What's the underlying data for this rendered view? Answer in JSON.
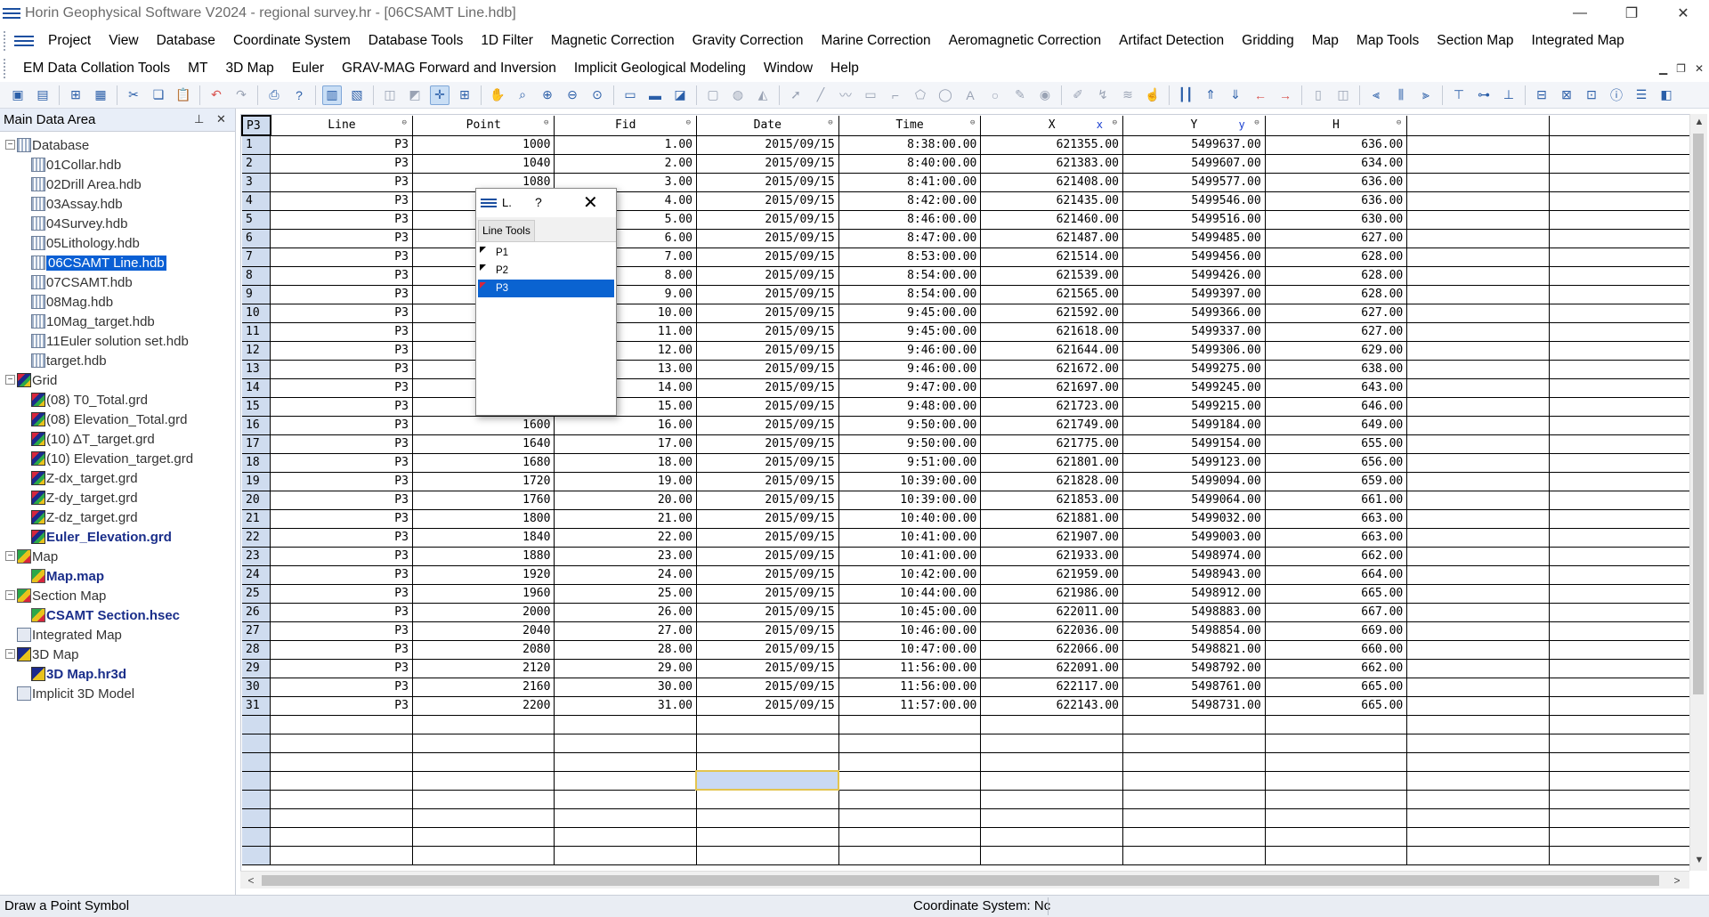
{
  "window": {
    "title": "Horin Geophysical Software V2024 - regional survey.hr - [06CSAMT Line.hdb]"
  },
  "menu1": [
    "Project",
    "View",
    "Database",
    "Coordinate System",
    "Database Tools",
    "1D Filter",
    "Magnetic Correction",
    "Gravity Correction",
    "Marine Correction",
    "Aeromagnetic Correction",
    "Artifact Detection",
    "Gridding",
    "Map",
    "Map Tools",
    "Section  Map",
    "Integrated Map"
  ],
  "menu2": [
    "EM Data Collation Tools",
    "MT",
    "3D Map",
    "Euler",
    "GRAV-MAG Forward and Inversion",
    "Implicit Geological Modeling",
    "Window",
    "Help"
  ],
  "panel": {
    "title": "Main Data Area"
  },
  "tree": {
    "database_label": "Database",
    "databases": [
      "01Collar.hdb",
      "02Drill Area.hdb",
      "03Assay.hdb",
      "04Survey.hdb",
      "05Lithology.hdb",
      "06CSAMT Line.hdb",
      "07CSAMT.hdb",
      "08Mag.hdb",
      "10Mag_target.hdb",
      "11Euler solution set.hdb",
      "target.hdb"
    ],
    "selected_database": "06CSAMT Line.hdb",
    "grid_label": "Grid",
    "grids": [
      "(08)  T0_Total.grd",
      "(08)  Elevation_Total.grd",
      "(10)  ΔT_target.grd",
      "(10)  Elevation_target.grd",
      "Z-dx_target.grd",
      "Z-dy_target.grd",
      "Z-dz_target.grd",
      "Euler_Elevation.grd"
    ],
    "bold_grid": "Euler_Elevation.grd",
    "map_label": "Map",
    "map_item": "Map.map",
    "section_label": "Section Map",
    "section_item": "CSAMT Section.hsec",
    "integrated_label": "Integrated Map",
    "map3d_label": "3D Map",
    "map3d_item": "3D Map.hr3d",
    "implicit_label": "Implicit 3D Model"
  },
  "grid": {
    "corner": "P3",
    "columns": [
      {
        "name": "Line",
        "sub": ""
      },
      {
        "name": "Point",
        "sub": ""
      },
      {
        "name": "Fid",
        "sub": ""
      },
      {
        "name": "Date",
        "sub": ""
      },
      {
        "name": "Time",
        "sub": ""
      },
      {
        "name": "X",
        "sub": "x"
      },
      {
        "name": "Y",
        "sub": "y"
      },
      {
        "name": "H",
        "sub": ""
      },
      {
        "name": "",
        "sub": ""
      },
      {
        "name": "",
        "sub": ""
      }
    ],
    "rows": [
      [
        "P3",
        "1000",
        "1.00",
        "2015/09/15",
        "8:38:00.00",
        "621355.00",
        "5499637.00",
        "636.00"
      ],
      [
        "P3",
        "1040",
        "2.00",
        "2015/09/15",
        "8:40:00.00",
        "621383.00",
        "5499607.00",
        "634.00"
      ],
      [
        "P3",
        "1080",
        "3.00",
        "2015/09/15",
        "8:41:00.00",
        "621408.00",
        "5499577.00",
        "636.00"
      ],
      [
        "P3",
        "",
        "4.00",
        "2015/09/15",
        "8:42:00.00",
        "621435.00",
        "5499546.00",
        "636.00"
      ],
      [
        "P3",
        "",
        "5.00",
        "2015/09/15",
        "8:46:00.00",
        "621460.00",
        "5499516.00",
        "630.00"
      ],
      [
        "P3",
        "",
        "6.00",
        "2015/09/15",
        "8:47:00.00",
        "621487.00",
        "5499485.00",
        "627.00"
      ],
      [
        "P3",
        "",
        "7.00",
        "2015/09/15",
        "8:53:00.00",
        "621514.00",
        "5499456.00",
        "628.00"
      ],
      [
        "P3",
        "",
        "8.00",
        "2015/09/15",
        "8:54:00.00",
        "621539.00",
        "5499426.00",
        "628.00"
      ],
      [
        "P3",
        "",
        "9.00",
        "2015/09/15",
        "8:54:00.00",
        "621565.00",
        "5499397.00",
        "628.00"
      ],
      [
        "P3",
        "",
        "10.00",
        "2015/09/15",
        "9:45:00.00",
        "621592.00",
        "5499366.00",
        "627.00"
      ],
      [
        "P3",
        "",
        "11.00",
        "2015/09/15",
        "9:45:00.00",
        "621618.00",
        "5499337.00",
        "627.00"
      ],
      [
        "P3",
        "",
        "12.00",
        "2015/09/15",
        "9:46:00.00",
        "621644.00",
        "5499306.00",
        "629.00"
      ],
      [
        "P3",
        "",
        "13.00",
        "2015/09/15",
        "9:46:00.00",
        "621672.00",
        "5499275.00",
        "638.00"
      ],
      [
        "P3",
        "",
        "14.00",
        "2015/09/15",
        "9:47:00.00",
        "621697.00",
        "5499245.00",
        "643.00"
      ],
      [
        "P3",
        "",
        "15.00",
        "2015/09/15",
        "9:48:00.00",
        "621723.00",
        "5499215.00",
        "646.00"
      ],
      [
        "P3",
        "1600",
        "16.00",
        "2015/09/15",
        "9:50:00.00",
        "621749.00",
        "5499184.00",
        "649.00"
      ],
      [
        "P3",
        "1640",
        "17.00",
        "2015/09/15",
        "9:50:00.00",
        "621775.00",
        "5499154.00",
        "655.00"
      ],
      [
        "P3",
        "1680",
        "18.00",
        "2015/09/15",
        "9:51:00.00",
        "621801.00",
        "5499123.00",
        "656.00"
      ],
      [
        "P3",
        "1720",
        "19.00",
        "2015/09/15",
        "10:39:00.00",
        "621828.00",
        "5499094.00",
        "659.00"
      ],
      [
        "P3",
        "1760",
        "20.00",
        "2015/09/15",
        "10:39:00.00",
        "621853.00",
        "5499064.00",
        "661.00"
      ],
      [
        "P3",
        "1800",
        "21.00",
        "2015/09/15",
        "10:40:00.00",
        "621881.00",
        "5499032.00",
        "663.00"
      ],
      [
        "P3",
        "1840",
        "22.00",
        "2015/09/15",
        "10:41:00.00",
        "621907.00",
        "5499003.00",
        "663.00"
      ],
      [
        "P3",
        "1880",
        "23.00",
        "2015/09/15",
        "10:41:00.00",
        "621933.00",
        "5498974.00",
        "662.00"
      ],
      [
        "P3",
        "1920",
        "24.00",
        "2015/09/15",
        "10:42:00.00",
        "621959.00",
        "5498943.00",
        "664.00"
      ],
      [
        "P3",
        "1960",
        "25.00",
        "2015/09/15",
        "10:44:00.00",
        "621986.00",
        "5498912.00",
        "665.00"
      ],
      [
        "P3",
        "2000",
        "26.00",
        "2015/09/15",
        "10:45:00.00",
        "622011.00",
        "5498883.00",
        "667.00"
      ],
      [
        "P3",
        "2040",
        "27.00",
        "2015/09/15",
        "10:46:00.00",
        "622036.00",
        "5498854.00",
        "669.00"
      ],
      [
        "P3",
        "2080",
        "28.00",
        "2015/09/15",
        "10:47:00.00",
        "622066.00",
        "5498821.00",
        "660.00"
      ],
      [
        "P3",
        "2120",
        "29.00",
        "2015/09/15",
        "11:56:00.00",
        "622091.00",
        "5498792.00",
        "662.00"
      ],
      [
        "P3",
        "2160",
        "30.00",
        "2015/09/15",
        "11:56:00.00",
        "622117.00",
        "5498761.00",
        "665.00"
      ],
      [
        "P3",
        "2200",
        "31.00",
        "2015/09/15",
        "11:57:00.00",
        "622143.00",
        "5498731.00",
        "665.00"
      ]
    ],
    "empty_rows": 8
  },
  "dialog": {
    "title": "L.",
    "help": "?",
    "close": "✕",
    "tab": "Line Tools",
    "lines": [
      "P1",
      "P2",
      "P3"
    ],
    "selected_line": "P3"
  },
  "status": {
    "left": "Draw a Point Symbol",
    "coordinate": "Coordinate System: Nc"
  }
}
